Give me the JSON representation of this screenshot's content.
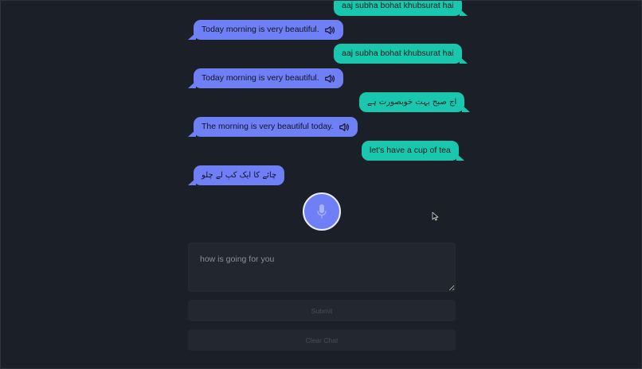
{
  "messages": [
    {
      "role": "user",
      "text": "aaj subha bohat khubsurat hai"
    },
    {
      "role": "bot",
      "text": "Today morning is very beautiful."
    },
    {
      "role": "user",
      "text": "aaj subha bohat khubsurat hai"
    },
    {
      "role": "bot",
      "text": "Today morning is very beautiful."
    },
    {
      "role": "user",
      "text": "اج صبح بہت خوبصورت ہے"
    },
    {
      "role": "bot",
      "text": "The morning is very beautiful today."
    },
    {
      "role": "user",
      "text": "let's have a cup of tea"
    },
    {
      "role": "bot",
      "text": "چائے کا ایک کپ لے چلو"
    }
  ],
  "input": {
    "placeholder": "how is going for you",
    "value": ""
  },
  "buttons": {
    "submit_label": "Submit",
    "clear_label": "Clear Chat"
  },
  "colors": {
    "background": "#1b1f27",
    "bot_bubble": "#6f7ff5",
    "user_bubble": "#19c6ae",
    "mic_button": "#6f7ff5"
  },
  "icons": {
    "speaker": "speaker-icon",
    "mic": "microphone-icon",
    "cursor": "mouse-cursor-icon"
  }
}
